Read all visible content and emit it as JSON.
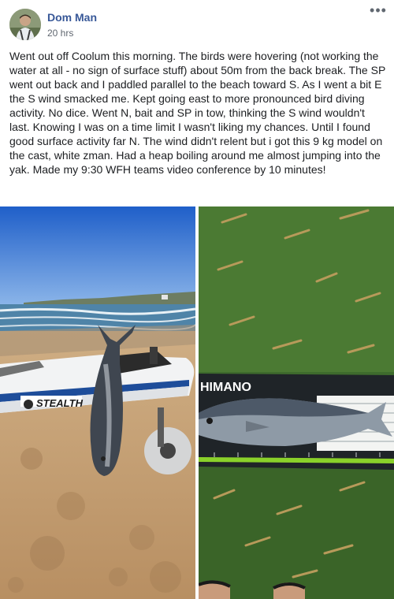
{
  "post": {
    "author": "Dom Man",
    "time": "20 hrs",
    "text": "Went out off Coolum this morning. The birds were hovering (not working the water at all - no sign of surface stuff) about 50m from the back break. The SP went out back and I paddled parallel to the beach toward S. As I went a bit E the S wind smacked me. Kept going east to more pronounced bird diving activity. No dice. Went N, bait and SP in tow, thinking the S wind wouldn't last. Knowing I was on a time limit I wasn't liking my chances. Until I found good surface activity far N. The wind didn't relent but i got this 9 kg model on the cast, white zman. Had a heap boiling around me almost jumping into the yak. Made my 9:30 WFH teams video conference by 10 minutes!",
    "more_icon": "•••"
  },
  "photos": {
    "kayak_brand": "STEALTH",
    "ruler_brand": "HIMANO"
  },
  "colors": {
    "name_link": "#385898",
    "meta_text": "#606770",
    "body_text": "#1c1e21"
  }
}
